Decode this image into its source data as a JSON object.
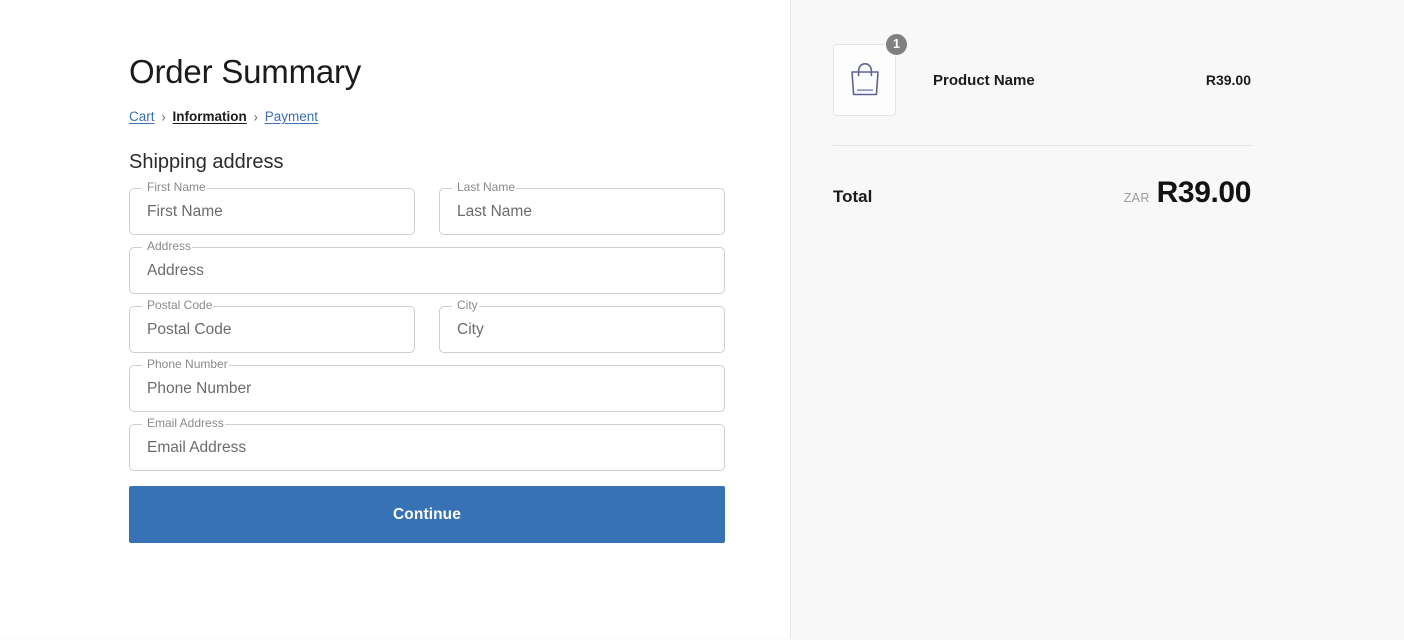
{
  "page": {
    "title": "Order Summary"
  },
  "breadcrumb": {
    "items": [
      {
        "label": "Cart",
        "state": "link"
      },
      {
        "label": "Information",
        "state": "current"
      },
      {
        "label": "Payment",
        "state": "link"
      }
    ],
    "separator": "›"
  },
  "shipping": {
    "section_title": "Shipping address",
    "fields": [
      {
        "name": "first-name",
        "label": "First Name",
        "placeholder": "First Name",
        "value": ""
      },
      {
        "name": "last-name",
        "label": "Last Name",
        "placeholder": "Last Name",
        "value": ""
      },
      {
        "name": "address",
        "label": "Address",
        "placeholder": "Address",
        "value": ""
      },
      {
        "name": "postal-code",
        "label": "Postal Code",
        "placeholder": "Postal Code",
        "value": ""
      },
      {
        "name": "city",
        "label": "City",
        "placeholder": "City",
        "value": ""
      },
      {
        "name": "phone-number",
        "label": "Phone Number",
        "placeholder": "Phone Number",
        "value": ""
      },
      {
        "name": "email-address",
        "label": "Email Address",
        "placeholder": "Email Address",
        "value": ""
      }
    ],
    "continue_label": "Continue"
  },
  "summary": {
    "product": {
      "name": "Product Name",
      "price": "R39.00",
      "quantity": "1",
      "thumbnail_icon": "shopping-bag-icon"
    },
    "total": {
      "label": "Total",
      "currency": "ZAR",
      "value": "R39.00"
    }
  },
  "colors": {
    "accent_button": "#3773b4",
    "link": "#3b6fb0",
    "badge": "#808080",
    "bag_icon": "#5e6195",
    "panel_background": "#f8f8f8",
    "field_border": "#cfcfcf"
  }
}
